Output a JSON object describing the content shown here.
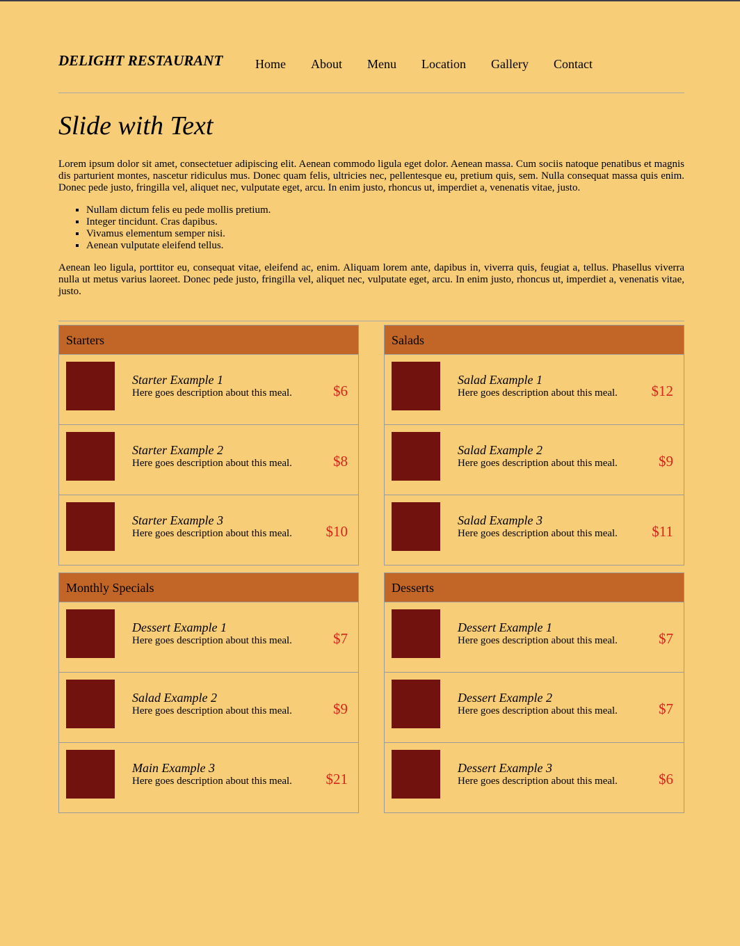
{
  "header": {
    "brand": "DELIGHT RESTAURANT",
    "nav": [
      "Home",
      "About",
      "Menu",
      "Location",
      "Gallery",
      "Contact"
    ]
  },
  "hero": {
    "title": "Slide with Text",
    "paragraph1": "Lorem ipsum dolor sit amet, consectetuer adipiscing elit. Aenean commodo ligula eget dolor. Aenean massa. Cum sociis natoque penatibus et magnis dis parturient montes, nascetur ridiculus mus. Donec quam felis, ultricies nec, pellentesque eu, pretium quis, sem. Nulla consequat massa quis enim. Donec pede justo, fringilla vel, aliquet nec, vulputate eget, arcu. In enim justo, rhoncus ut, imperdiet a, venenatis vitae, justo.",
    "bullets": [
      "Nullam dictum felis eu pede mollis pretium.",
      "Integer tincidunt. Cras dapibus.",
      "Vivamus elementum semper nisi.",
      "Aenean vulputate eleifend tellus."
    ],
    "paragraph2": "Aenean leo ligula, porttitor eu, consequat vitae, eleifend ac, enim. Aliquam lorem ante, dapibus in, viverra quis, feugiat a, tellus. Phasellus viverra nulla ut metus varius laoreet. Donec pede justo, fringilla vel, aliquet nec, vulputate eget, arcu. In enim justo, rhoncus ut, imperdiet a, venenatis vitae, justo."
  },
  "menu": {
    "sections": [
      {
        "title": "Starters",
        "items": [
          {
            "name": "Starter Example 1",
            "desc": "Here goes description about this meal.",
            "price": "$6"
          },
          {
            "name": "Starter Example 2",
            "desc": "Here goes description about this meal.",
            "price": "$8"
          },
          {
            "name": "Starter Example 3",
            "desc": "Here goes description about this meal.",
            "price": "$10"
          }
        ]
      },
      {
        "title": "Salads",
        "items": [
          {
            "name": "Salad Example 1",
            "desc": "Here goes description about this meal.",
            "price": "$12"
          },
          {
            "name": "Salad Example 2",
            "desc": "Here goes description about this meal.",
            "price": "$9"
          },
          {
            "name": "Salad Example 3",
            "desc": "Here goes description about this meal.",
            "price": "$11"
          }
        ]
      },
      {
        "title": "Monthly Specials",
        "items": [
          {
            "name": "Dessert Example 1",
            "desc": "Here goes description about this meal.",
            "price": "$7"
          },
          {
            "name": "Salad Example 2",
            "desc": "Here goes description about this meal.",
            "price": "$9"
          },
          {
            "name": "Main Example 3",
            "desc": "Here goes description about this meal.",
            "price": "$21"
          }
        ]
      },
      {
        "title": "Desserts",
        "items": [
          {
            "name": "Dessert Example 1",
            "desc": "Here goes description about this meal.",
            "price": "$7"
          },
          {
            "name": "Dessert Example 2",
            "desc": "Here goes description about this meal.",
            "price": "$7"
          },
          {
            "name": "Dessert Example 3",
            "desc": "Here goes description about this meal.",
            "price": "$6"
          }
        ]
      }
    ]
  },
  "colors": {
    "background": "#f7cd77",
    "section_header": "#c26627",
    "thumbnail": "#71120f",
    "price": "#d9251c"
  }
}
